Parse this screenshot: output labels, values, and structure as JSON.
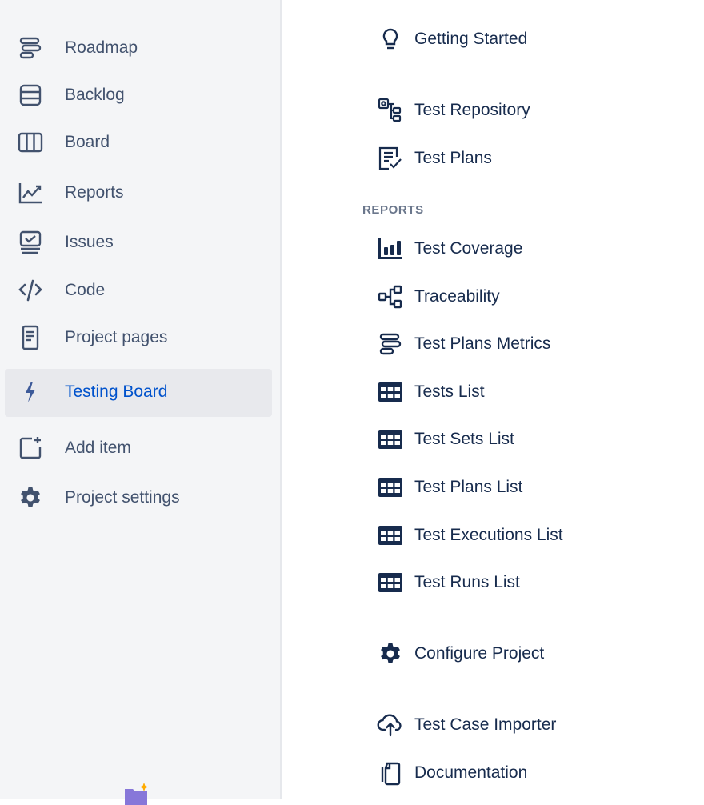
{
  "sidebar": {
    "items": [
      {
        "label": "Roadmap",
        "icon": "roadmap-icon"
      },
      {
        "label": "Backlog",
        "icon": "backlog-icon"
      },
      {
        "label": "Board",
        "icon": "board-icon"
      },
      {
        "label": "Reports",
        "icon": "reports-icon"
      },
      {
        "label": "Issues",
        "icon": "issues-icon"
      },
      {
        "label": "Code",
        "icon": "code-icon"
      },
      {
        "label": "Project pages",
        "icon": "page-icon"
      },
      {
        "label": "Testing Board",
        "icon": "lightning-icon",
        "active": true
      },
      {
        "label": "Add item",
        "icon": "add-item-icon"
      },
      {
        "label": "Project settings",
        "icon": "gear-icon"
      }
    ]
  },
  "menu": {
    "getting_started": "Getting Started",
    "test_repository": "Test Repository",
    "test_plans": "Test Plans",
    "reports_heading": "REPORTS",
    "reports": [
      {
        "label": "Test Coverage",
        "icon": "bar-chart-icon"
      },
      {
        "label": "Traceability",
        "icon": "tree-icon"
      },
      {
        "label": "Test Plans Metrics",
        "icon": "roadmap-icon"
      },
      {
        "label": "Tests List",
        "icon": "table-icon"
      },
      {
        "label": "Test Sets List",
        "icon": "table-icon"
      },
      {
        "label": "Test Plans List",
        "icon": "table-icon"
      },
      {
        "label": "Test Executions List",
        "icon": "table-icon"
      },
      {
        "label": "Test Runs List",
        "icon": "table-icon"
      }
    ],
    "configure_project": "Configure Project",
    "test_case_importer": "Test Case Importer",
    "documentation": "Documentation"
  },
  "colors": {
    "sidebar_bg": "#f4f5f7",
    "active_text": "#0052cc",
    "text": "#172b4d",
    "muted_text": "#42526e",
    "heading": "#6b778c"
  }
}
